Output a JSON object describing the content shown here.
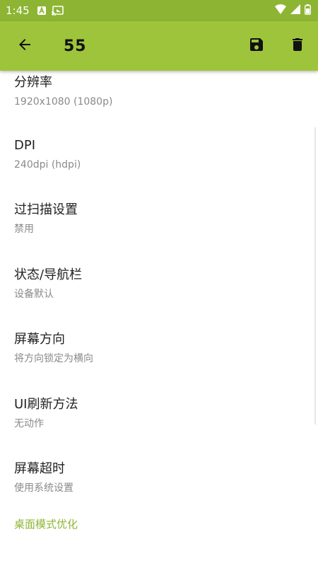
{
  "status_bar": {
    "time": "1:45",
    "icons": [
      "notification-a-icon",
      "cast-icon",
      "wifi-icon",
      "signal-icon",
      "battery-icon"
    ]
  },
  "app_bar": {
    "title": "55",
    "back_icon": "arrow-back-icon",
    "actions": [
      "save-icon",
      "delete-icon"
    ]
  },
  "settings": [
    {
      "title": "分辨率",
      "summary": "1920x1080 (1080p)"
    },
    {
      "title": "DPI",
      "summary": "240dpi (hdpi)"
    },
    {
      "title": "过扫描设置",
      "summary": "禁用"
    },
    {
      "title": "状态/导航栏",
      "summary": "设备默认"
    },
    {
      "title": "屏幕方向",
      "summary": "将方向锁定为横向"
    },
    {
      "title": "UI刷新方法",
      "summary": "无动作"
    },
    {
      "title": "屏幕超时",
      "summary": "使用系统设置"
    }
  ],
  "category": {
    "title": "桌面模式优化"
  },
  "colors": {
    "status_bar": "#8db533",
    "app_bar": "#9ec43c",
    "accent": "#8db533",
    "title_text": "#222222",
    "summary_text": "#8a8a8a"
  }
}
